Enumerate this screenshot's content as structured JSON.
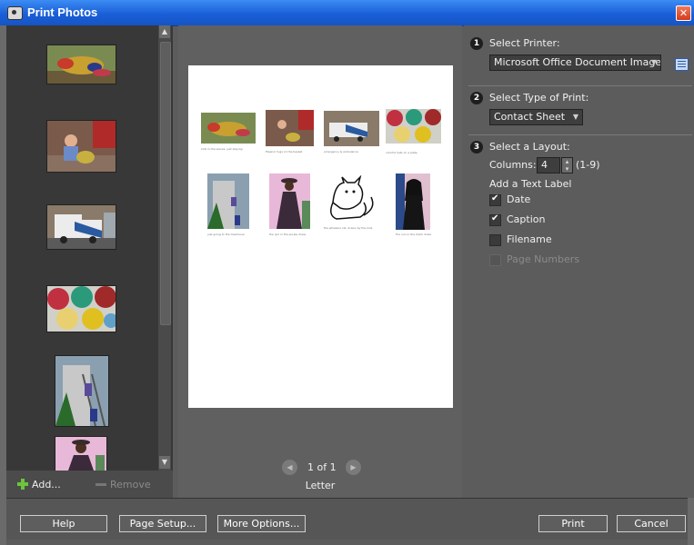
{
  "window": {
    "title": "Print Photos",
    "close_symbol": "✕"
  },
  "left_panel": {
    "add_label": "Add...",
    "remove_label": "Remove",
    "thumbnails": [
      "kids-playing-grass",
      "toddler-with-basket",
      "ambulance-truck",
      "colorful-hats",
      "kids-on-ladder",
      "girl-in-purple-dress"
    ]
  },
  "preview": {
    "page_indicator": "1 of 1",
    "paper_size": "Letter",
    "captions": [
      "kids in the leaves, just playing",
      "Eleanor tugs on the basket",
      "emergency & ambulance",
      "colorful hats on a plate",
      "just going to the treehouse",
      "Her girl in the purple dress",
      "the whiskers cat, drawn by the kids",
      "the nun in the black dress"
    ]
  },
  "options": {
    "step1": {
      "number": "1",
      "label": "Select Printer:",
      "printer_value": "Microsoft Office Document Image"
    },
    "step2": {
      "number": "2",
      "label": "Select Type of Print:",
      "type_value": "Contact Sheet"
    },
    "step3": {
      "number": "3",
      "label": "Select a Layout:",
      "columns_label": "Columns:",
      "columns_value": "4",
      "columns_range": "(1-9)",
      "text_label_heading": "Add a Text Label",
      "checkboxes": [
        {
          "label": "Date",
          "checked": true,
          "enabled": true
        },
        {
          "label": "Caption",
          "checked": true,
          "enabled": true
        },
        {
          "label": "Filename",
          "checked": false,
          "enabled": true
        },
        {
          "label": "Page Numbers",
          "checked": false,
          "enabled": false
        }
      ]
    }
  },
  "buttons": {
    "help": "Help",
    "page_setup": "Page Setup...",
    "more_options": "More Options...",
    "print": "Print",
    "cancel": "Cancel"
  }
}
